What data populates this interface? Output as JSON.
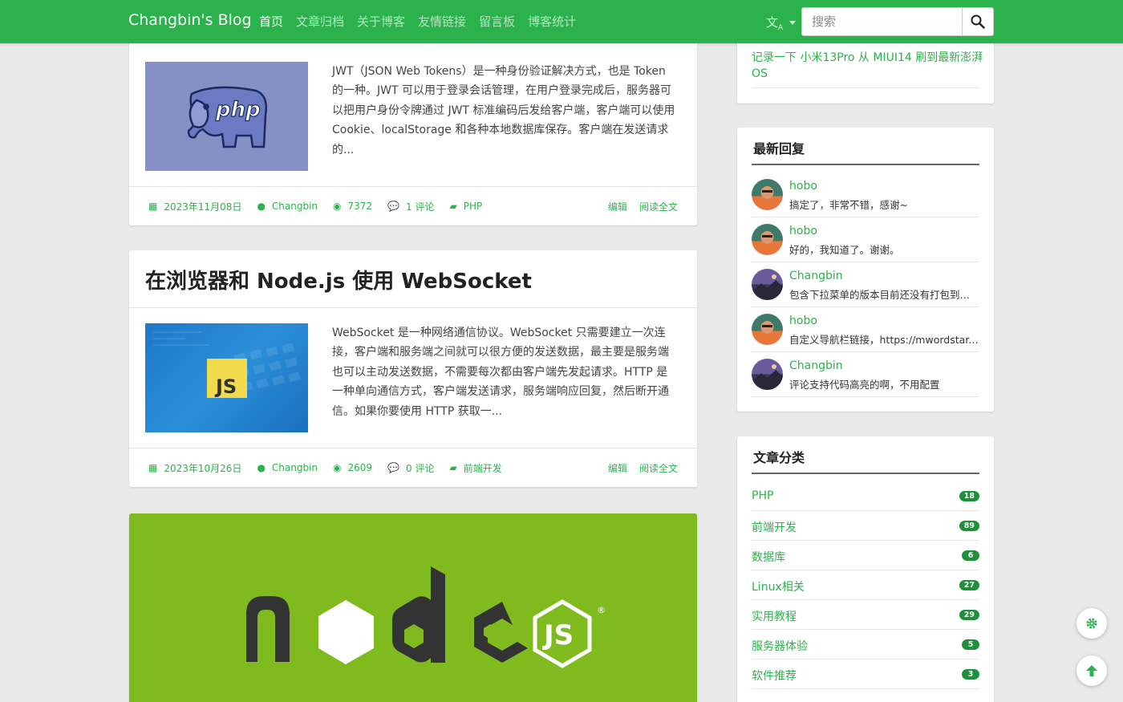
{
  "navbar": {
    "brand": "Changbin's Blog",
    "links": [
      "首页",
      "文章归档",
      "关于博客",
      "友情链接",
      "留言板",
      "博客统计"
    ],
    "lang_icon": "translate-icon",
    "search_placeholder": "搜索"
  },
  "posts": [
    {
      "excerpt": "JWT（JSON Web Tokens）是一种身份验证解决方式，也是 Token 的一种。JWT 可以用于登录会话管理，在用户登录完成后，服务器可以把用户身份令牌通过 JWT 标准编码后发给客户端，客户端可以使用 Cookie、localStorage 和各种本地数据库保存。客户端在发送请求的...",
      "date": "2023年11月08日",
      "author": "Changbin",
      "views": "7372",
      "comments": "1 评论",
      "category": "PHP",
      "edit": "编辑",
      "read_more": "阅读全文"
    },
    {
      "title": "在浏览器和 Node.js 使用 WebSocket",
      "excerpt": "WebSocket 是一种网络通信协议。WebSocket 只需要建立一次连接，客户端和服务端之间就可以很方便的发送数据，最主要是服务端也可以主动发送数据，不需要每次都由客户端先发起请求。HTTP 是一种单向通信方式，客户端发送请求，服务端响应回复，然后断开通信。如果你要使用 HTTP 获取一...",
      "date": "2023年10月26日",
      "author": "Changbin",
      "views": "2609",
      "comments": "0 评论",
      "category": "前端开发",
      "edit": "编辑",
      "read_more": "阅读全文"
    }
  ],
  "featured_image_text": "node",
  "sidebar": {
    "recent_post_link": "记录一下 小米13Pro 从 MIUI14 刷到最新澎湃OS",
    "latest_replies": {
      "title": "最新回复",
      "items": [
        {
          "name": "hobo",
          "content": "搞定了，非常不错，感谢~"
        },
        {
          "name": "hobo",
          "content": "好的，我知道了。谢谢。"
        },
        {
          "name": "Changbin",
          "content": "包含下拉菜单的版本目前还没有打包到发布版本中"
        },
        {
          "name": "hobo",
          "content": "自定义导航栏链接，https://mwordstar.com"
        },
        {
          "name": "Changbin",
          "content": "评论支持代码高亮的啊，不用配置"
        }
      ]
    },
    "categories": {
      "title": "文章分类",
      "items": [
        {
          "name": "PHP",
          "count": "18"
        },
        {
          "name": "前端开发",
          "count": "89"
        },
        {
          "name": "数据库",
          "count": "6"
        },
        {
          "name": "Linux相关",
          "count": "27"
        },
        {
          "name": "实用教程",
          "count": "29"
        },
        {
          "name": "服务器体验",
          "count": "5"
        },
        {
          "name": "软件推荐",
          "count": "3"
        }
      ]
    }
  },
  "colors": {
    "primary": "#2bb24c",
    "badge": "#1e8f3a",
    "node_green": "#7fbb1e"
  }
}
